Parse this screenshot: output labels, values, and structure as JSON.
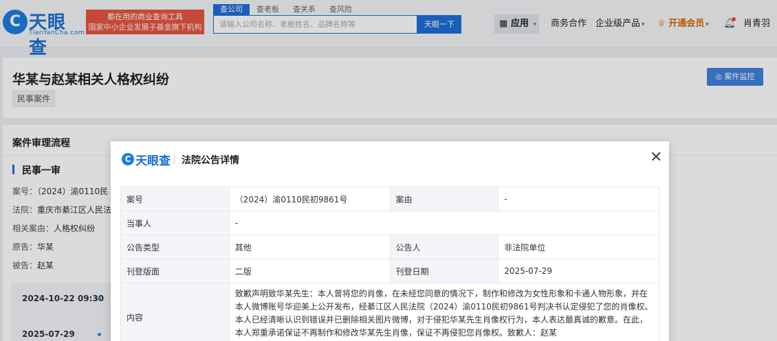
{
  "header": {
    "logo_mark": "C",
    "logo_text": "天眼查",
    "logo_sub": "TianYanCha.com",
    "slogan_line1": "都在用的商业查询工具",
    "slogan_line2": "国家中小企业发展子基金旗下机构",
    "search_tabs": [
      "查公司",
      "查老板",
      "查关系",
      "查风险"
    ],
    "search_placeholder": "请输入公司名称、老板姓名、品牌名称等",
    "search_button": "天眼一下",
    "nav_app": "应用",
    "nav_items": [
      "商务合作",
      "企业级产品",
      "开通会员",
      "肖青羽"
    ],
    "accent": "#1e6fd9"
  },
  "case": {
    "title": "华某与赵某相关人格权纠纷",
    "tag": "民事案件",
    "monitor_button": "案件监控"
  },
  "flow": {
    "title": "案件审理流程",
    "stage": "民事一审",
    "meta": [
      {
        "label": "案号：",
        "value": "（2024）渝0110民"
      },
      {
        "label": "法院：",
        "value": "重庆市綦江区人民法"
      },
      {
        "label": "相关案由：",
        "value": "人格权纠纷"
      },
      {
        "label": "原告：",
        "value": "华某"
      },
      {
        "label": "被告：",
        "value": "赵某"
      }
    ],
    "timeline": [
      "2024-10-22 09:30",
      "2025-07-29"
    ]
  },
  "modal": {
    "logo_text": "天眼查",
    "title": "法院公告详情",
    "close_icon": "close-icon",
    "fields": {
      "case_no_label": "案号",
      "case_no": "（2024）渝0110民初9861号",
      "cause_label": "案由",
      "cause": "-",
      "party_label": "当事人",
      "party": "-",
      "type_label": "公告类型",
      "type": "其他",
      "announcer_label": "公告人",
      "announcer": "非法院单位",
      "page_label": "刊登版面",
      "page": "二版",
      "date_label": "刊登日期",
      "date": "2025-07-29",
      "content_label": "内容",
      "content": "致歉声明致华某先生：本人曾将您的肖像，在未经您同意的情况下，制作和修改为女性形象和卡通人物形象，并在本人微博账号华迎美上公开发布，经綦江区人民法院（2024）渝0110民初9861号判决书认定侵犯了您的肖像权。本人已经清晰认识到错误并已删除相关图片微博，对于侵犯华某先生肖像权行为，本人表达最真诚的歉意。在此，本人郑重承诺保证不再制作和修改华某先生肖像，保证不再侵犯您肖像权。致歉人：赵某"
    }
  }
}
